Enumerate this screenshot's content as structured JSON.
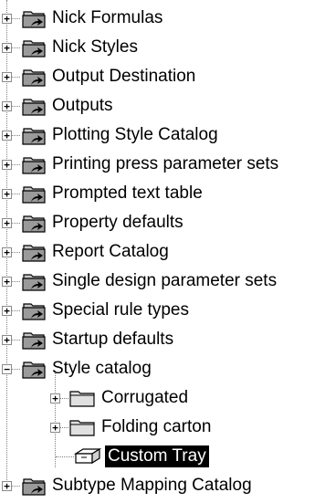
{
  "tree": {
    "items": [
      {
        "label": "Nick Formulas",
        "expander": "+"
      },
      {
        "label": "Nick Styles",
        "expander": "+"
      },
      {
        "label": "Output Destination",
        "expander": "+"
      },
      {
        "label": "Outputs",
        "expander": "+"
      },
      {
        "label": "Plotting Style Catalog",
        "expander": "+"
      },
      {
        "label": "Printing press parameter sets",
        "expander": "+"
      },
      {
        "label": "Prompted text table",
        "expander": "+"
      },
      {
        "label": "Property defaults",
        "expander": "+"
      },
      {
        "label": "Report Catalog",
        "expander": "+"
      },
      {
        "label": "Single design parameter sets",
        "expander": "+"
      },
      {
        "label": "Special rule types",
        "expander": "+"
      },
      {
        "label": "Startup defaults",
        "expander": "+"
      },
      {
        "label": "Style catalog",
        "expander": "−"
      },
      {
        "label": "Corrugated",
        "expander": "+"
      },
      {
        "label": "Folding carton",
        "expander": "+"
      },
      {
        "label": "Custom Tray"
      },
      {
        "label": "Subtype Mapping Catalog",
        "expander": "+"
      }
    ]
  },
  "colors": {
    "selection_bg": "#000000",
    "selection_fg": "#ffffff",
    "connector": "#808080"
  },
  "icons": {
    "catalog": "folder-with-arrow-icon",
    "subfolder": "folder-icon",
    "leaf": "tray-icon"
  }
}
